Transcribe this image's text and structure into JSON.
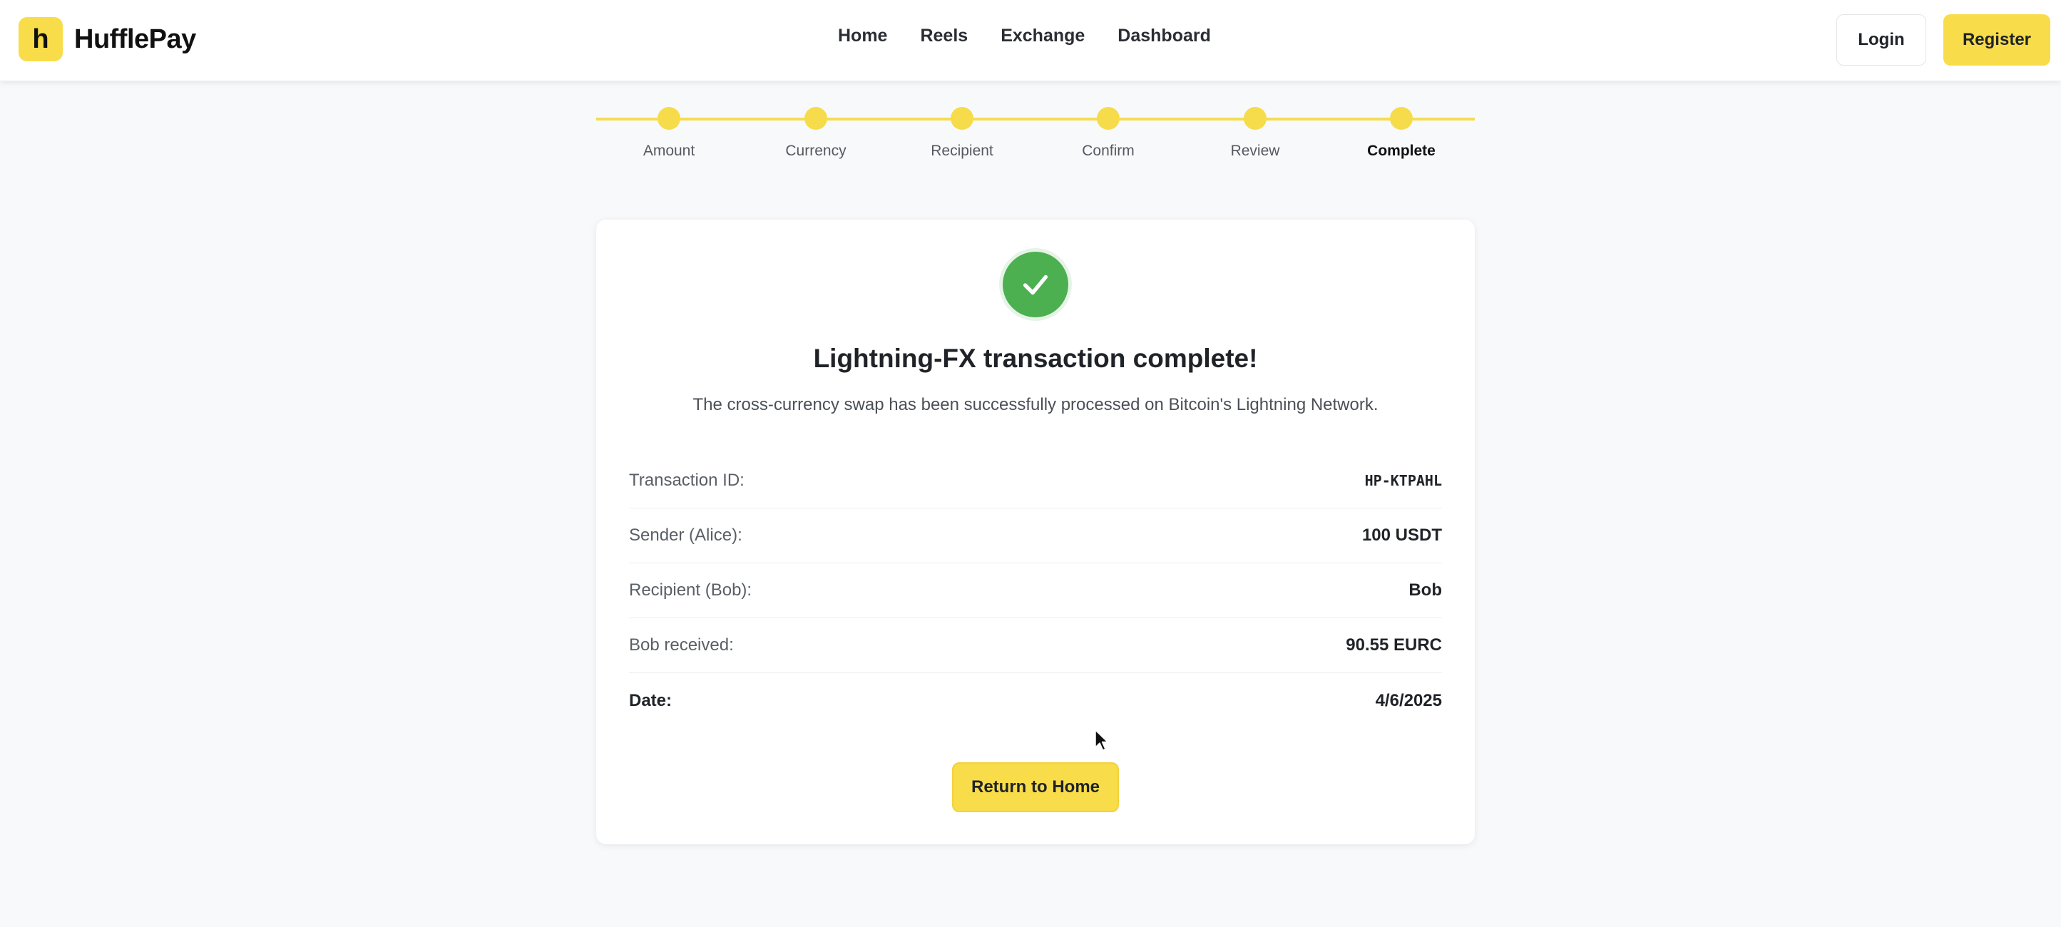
{
  "brand": {
    "logo_letter": "h",
    "name": "HufflePay",
    "accent": "#f9dc4a"
  },
  "nav": {
    "items": [
      "Home",
      "Reels",
      "Exchange",
      "Dashboard"
    ]
  },
  "auth": {
    "login_label": "Login",
    "register_label": "Register"
  },
  "stepper": {
    "steps": [
      "Amount",
      "Currency",
      "Recipient",
      "Confirm",
      "Review",
      "Complete"
    ],
    "current": "Complete"
  },
  "result": {
    "icon": "check-icon",
    "success_color": "#4caf50",
    "title": "Lightning-FX transaction complete!",
    "subtitle": "The cross-currency swap has been successfully processed on Bitcoin's Lightning Network.",
    "details": [
      {
        "label": "Transaction ID:",
        "value": "HP-KTPAHL"
      },
      {
        "label": "Sender (Alice):",
        "value": "100 USDT"
      },
      {
        "label": "Recipient (Bob):",
        "value": "Bob"
      },
      {
        "label": "Bob received:",
        "value": "90.55 EURC"
      },
      {
        "label": "Date:",
        "value": "4/6/2025"
      }
    ],
    "return_label": "Return to Home"
  }
}
